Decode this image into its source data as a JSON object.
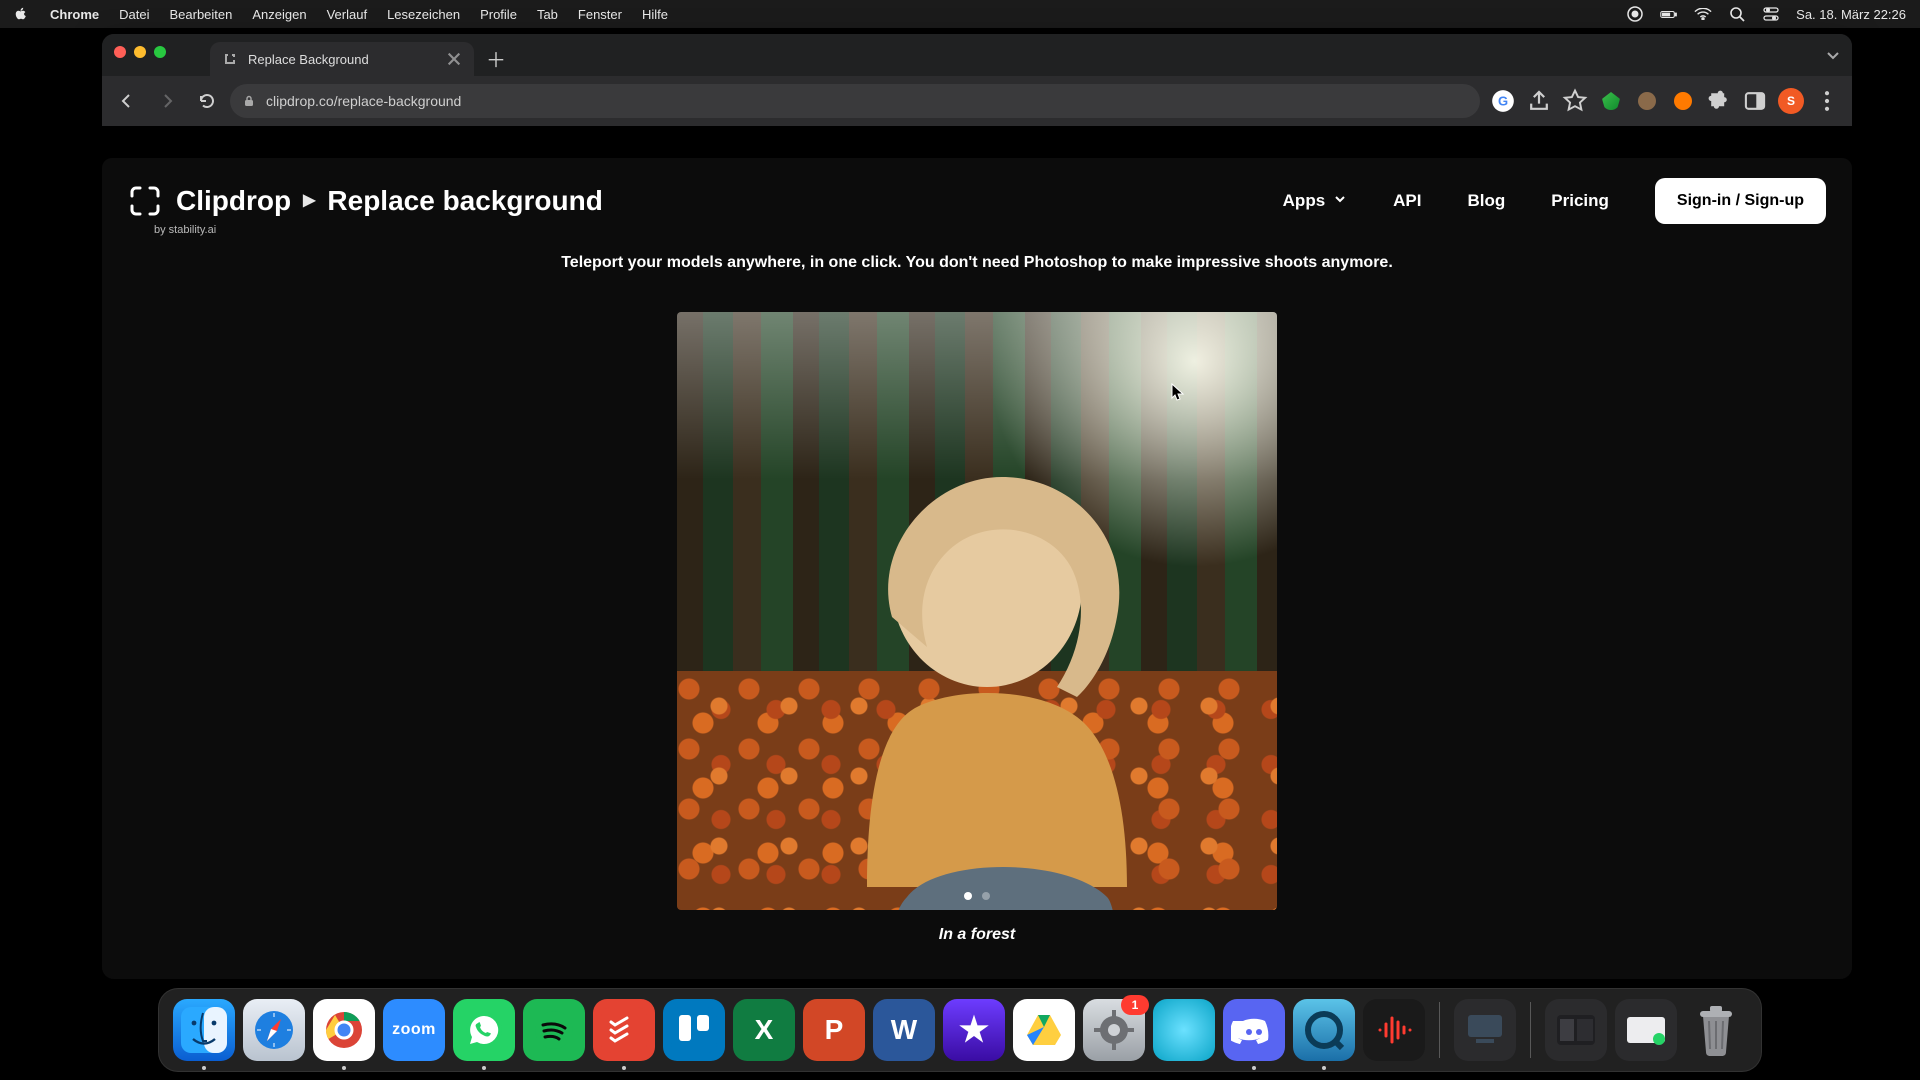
{
  "macos": {
    "app_name": "Chrome",
    "menu": [
      "Datei",
      "Bearbeiten",
      "Anzeigen",
      "Verlauf",
      "Lesezeichen",
      "Profile",
      "Tab",
      "Fenster",
      "Hilfe"
    ],
    "datetime": "Sa. 18. März  22:26"
  },
  "browser": {
    "tab_title": "Replace Background",
    "url": "clipdrop.co/replace-background"
  },
  "page": {
    "brand": "Clipdrop",
    "section": "Replace background",
    "byline": "by stability.ai",
    "nav": {
      "apps": "Apps",
      "api": "API",
      "blog": "Blog",
      "pricing": "Pricing"
    },
    "signin": "Sign-in / Sign-up",
    "tagline": "Teleport your models anywhere, in one click. You don't need Photoshop to make impressive shoots anymore.",
    "demo_caption": "In a forest"
  },
  "dock": {
    "settings_badge": "1",
    "zoom_label": "zoom"
  }
}
